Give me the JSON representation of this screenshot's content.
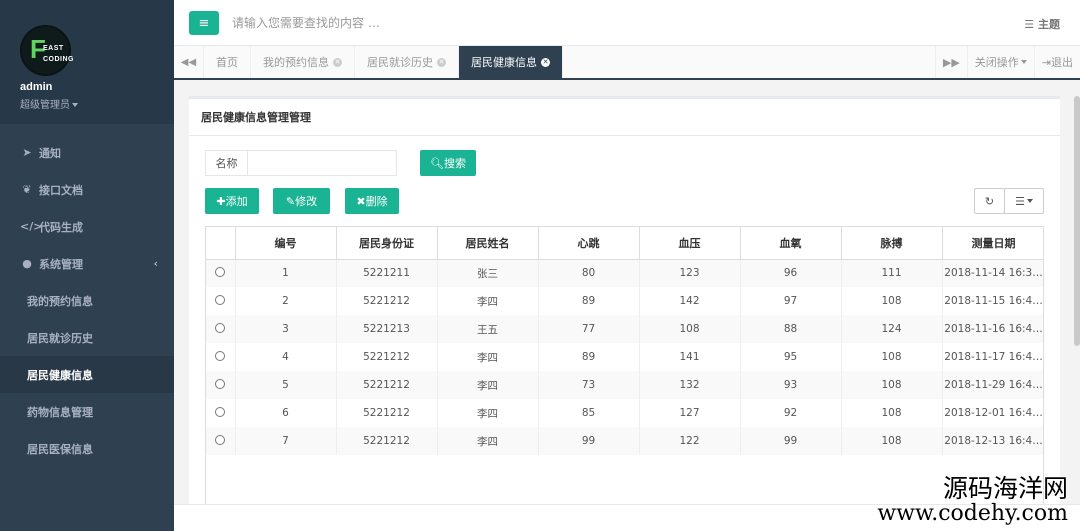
{
  "app": {
    "logo_line1": "EAST",
    "logo_line2": "CODING",
    "logo_letter": "F",
    "user_name": "admin",
    "user_role": "超级管理员"
  },
  "sidebar": {
    "items": [
      {
        "label": "通知",
        "icon": "paper-plane-icon"
      },
      {
        "label": "接口文档",
        "icon": "leaf-icon"
      },
      {
        "label": "代码生成",
        "icon": "code-icon"
      },
      {
        "label": "系统管理",
        "icon": "user-icon"
      },
      {
        "label": "我的预约信息"
      },
      {
        "label": "居民就诊历史"
      },
      {
        "label": "居民健康信息"
      },
      {
        "label": "药物信息管理"
      },
      {
        "label": "居民医保信息"
      }
    ]
  },
  "topbar": {
    "search_placeholder": "请输入您需要查找的内容 …",
    "theme_label": "主题"
  },
  "tabs": {
    "items": [
      "首页",
      "我的预约信息",
      "居民就诊历史",
      "居民健康信息"
    ],
    "close_ops": "关闭操作",
    "logout": "退出"
  },
  "panel": {
    "title": "居民健康信息管理管理",
    "name_label": "名称",
    "search_btn": "搜索",
    "add_btn": "添加",
    "edit_btn": "修改",
    "delete_btn": "删除"
  },
  "table": {
    "columns": [
      "编号",
      "居民身份证",
      "居民姓名",
      "心跳",
      "血压",
      "血氧",
      "脉搏",
      "测量日期"
    ],
    "rows": [
      [
        "1",
        "5221211",
        "张三",
        "80",
        "123",
        "96",
        "111",
        "2018-11-14 16:3…"
      ],
      [
        "2",
        "5221212",
        "李四",
        "89",
        "142",
        "97",
        "108",
        "2018-11-15 16:4…"
      ],
      [
        "3",
        "5221213",
        "王五",
        "77",
        "108",
        "88",
        "124",
        "2018-11-16 16:4…"
      ],
      [
        "4",
        "5221212",
        "李四",
        "89",
        "141",
        "95",
        "108",
        "2018-11-17 16:4…"
      ],
      [
        "5",
        "5221212",
        "李四",
        "73",
        "132",
        "93",
        "108",
        "2018-11-29 16:4…"
      ],
      [
        "6",
        "5221212",
        "李四",
        "85",
        "127",
        "92",
        "108",
        "2018-12-01 16:4…"
      ],
      [
        "7",
        "5221212",
        "李四",
        "99",
        "122",
        "99",
        "108",
        "2018-12-13 16:4…"
      ]
    ]
  },
  "watermark": {
    "line1": "源码海洋网",
    "line2": "www.codehy.com"
  },
  "colors": {
    "sidebar_bg": "#2f4050",
    "accent": "#1ab394"
  }
}
